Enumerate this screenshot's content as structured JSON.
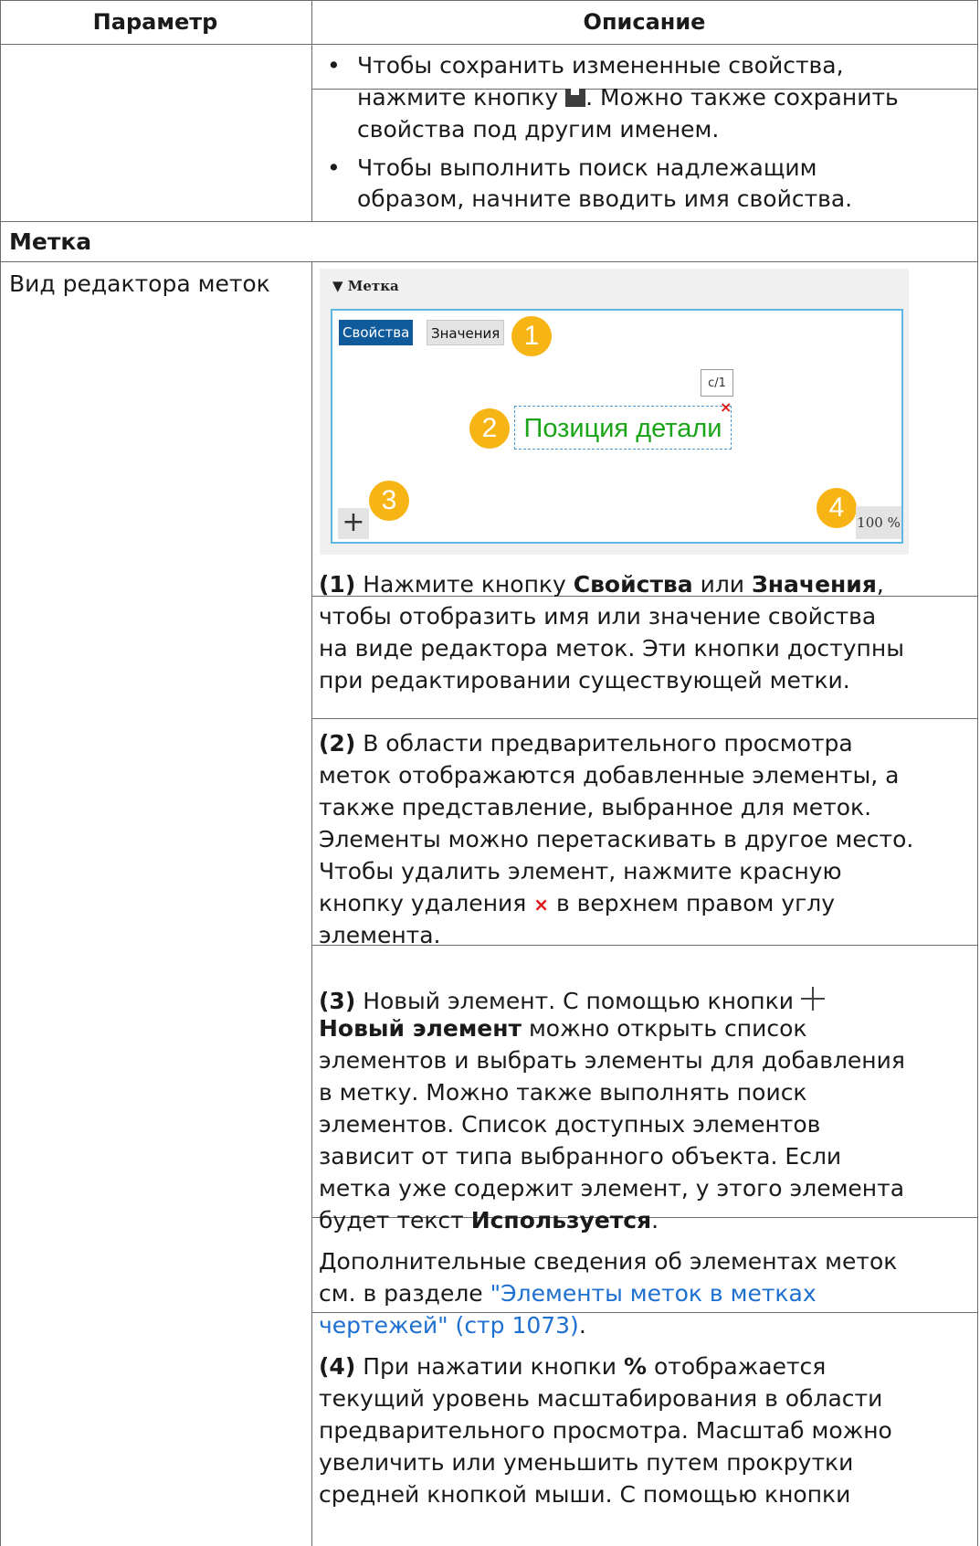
{
  "header": {
    "param": "Параметр",
    "desc": "Описание"
  },
  "top_row": {
    "bullet1_l1": "Чтобы сохранить измененные свойства,",
    "bullet1_l2a": "нажмите кнопку",
    "bullet1_l2b": ". Можно также сохранить",
    "bullet1_l3": "свойства под другим именем.",
    "bullet2_l1": "Чтобы выполнить поиск надлежащим",
    "bullet2_l2": "образом, начните вводить имя свойства.",
    "bullet_char": "•"
  },
  "section": {
    "title": "Метка"
  },
  "row": {
    "param": "Вид редактора меток",
    "shot": {
      "title": "▼ Метка",
      "tab_props": "Свойства",
      "tab_vals": "Значения",
      "badge1": "1",
      "badge2": "2",
      "badge3": "3",
      "badge4": "4",
      "c1": "c/1",
      "element": "Позиция детали",
      "remove": "×",
      "plus": "+",
      "zoom": "100 %"
    },
    "p1": {
      "num": "(1)",
      "a": " Нажмите кнопку ",
      "b1": "Свойства",
      "c": " или ",
      "b2": "Значения",
      "d": ",",
      "l2": "чтобы отобразить имя или значение свойства",
      "l3": "на виде редактора меток. Эти кнопки доступны",
      "l4": "при редактировании существующей метки."
    },
    "p2": {
      "num": "(2)",
      "l1": " В области предварительного просмотра",
      "l2": "меток отображаются добавленные элементы, а",
      "l3": "также представление, выбранное для меток.",
      "l4": "Элементы можно перетаскивать в другое место.",
      "l5": "Чтобы удалить элемент, нажмите красную",
      "l6a": "кнопку удаления",
      "x": "×",
      "l6b": "в верхнем правом углу",
      "l7": "элемента."
    },
    "p3": {
      "num": "(3)",
      "l1": " Новый элемент. С помощью кнопки",
      "b": "Новый элемент",
      "l2": " можно открыть список",
      "l3": "элементов и выбрать элементы для добавления",
      "l4": "в метку. Можно также выполнять поиск",
      "l5": "элементов. Список доступных элементов",
      "l6": "зависит от типа выбранного объекта. Если",
      "l7": "метка уже содержит элемент, у этого элемента",
      "l8a": "будет текст ",
      "l8b": "Используется",
      "l8c": "."
    },
    "p4": {
      "l1": "Дополнительные сведения об элементах меток",
      "l2a": "см. в разделе ",
      "link1": "\"Элементы меток в метках",
      "link2": "чертежей\" (стр 1073)",
      "l3end": "."
    },
    "p5": {
      "num": "(4)",
      "a": " При нажатии кнопки ",
      "b": "%",
      "c": " отображается",
      "l2": "текущий уровень масштабирования в области",
      "l3": "предварительного просмотра. Масштаб можно",
      "l4": "увеличить или уменьшить путем прокрутки",
      "l5": "средней кнопкой мыши. С помощью кнопки"
    }
  }
}
